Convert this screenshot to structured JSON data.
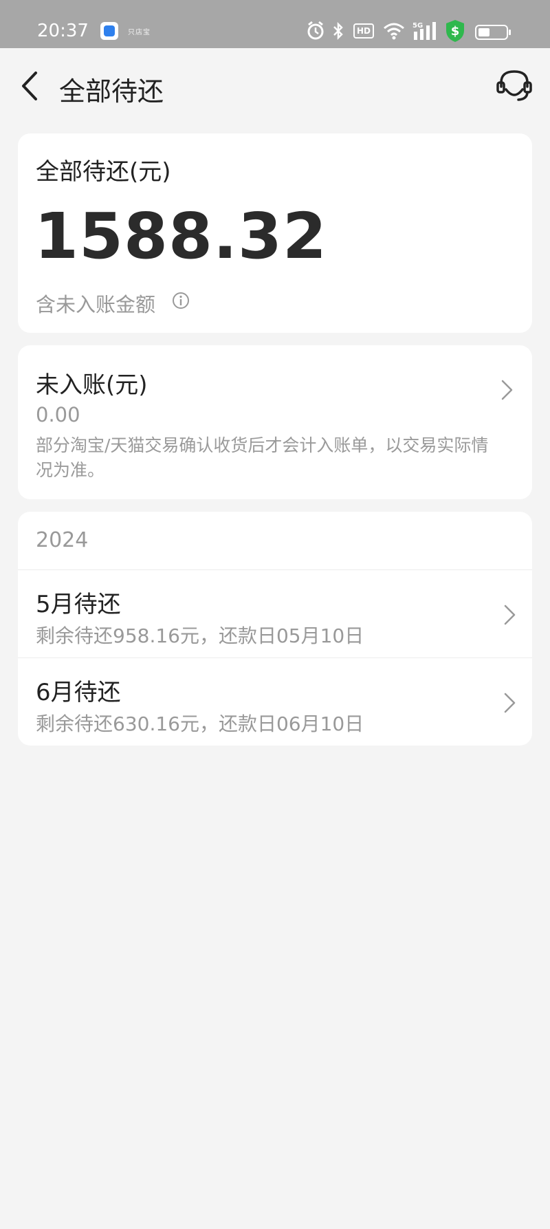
{
  "status_bar": {
    "time": "20:37",
    "app_badge_text": "只店宝",
    "hd_label": "HD",
    "network": "5G",
    "icons": [
      "alarm-icon",
      "bluetooth-icon",
      "hd-icon",
      "wifi-icon",
      "signal-icon",
      "security-shield-icon",
      "battery-icon"
    ]
  },
  "header": {
    "title": "全部待还",
    "back_icon": "chevron-left-icon",
    "service_icon": "customer-service-icon"
  },
  "total_card": {
    "label": "全部待还(元)",
    "amount": "1588.32",
    "note": "含未入账金额",
    "info_icon": "info-icon"
  },
  "pending_card": {
    "label": "未入账(元)",
    "amount": "0.00",
    "description": "部分淘宝/天猫交易确认收货后才会计入账单，以交易实际情况为准。"
  },
  "months_card": {
    "year": "2024",
    "items": [
      {
        "title": "5月待还",
        "subtitle": "剩余待还958.16元，还款日05月10日"
      },
      {
        "title": "6月待还",
        "subtitle": "剩余待还630.16元，还款日06月10日"
      }
    ]
  },
  "colors": {
    "status_bar_bg": "#a7a7a7",
    "page_bg": "#f4f4f4",
    "card_bg": "#ffffff",
    "primary_text": "#222222",
    "secondary_text": "#999999",
    "shield_green": "#2fb84d"
  }
}
